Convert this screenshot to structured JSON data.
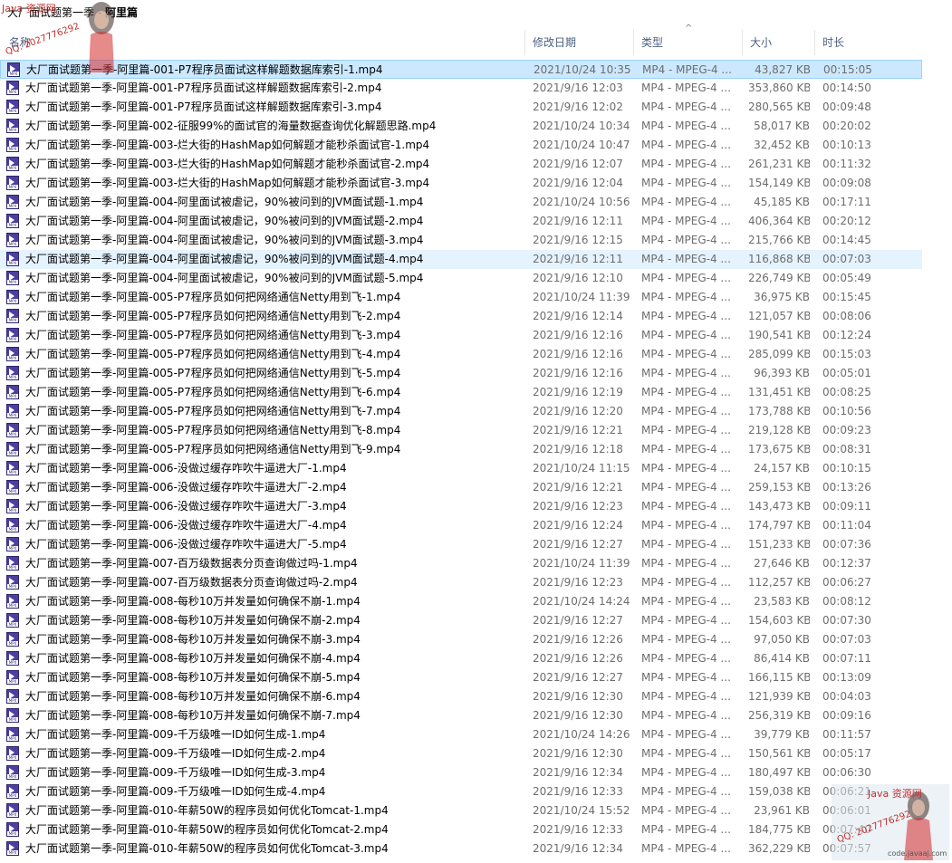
{
  "window": {
    "title_prefix": "大厂面试题第一季",
    "title_bold": "阿里篇"
  },
  "columns": {
    "name": "名称",
    "date": "修改日期",
    "type": "类型",
    "size": "大小",
    "duration": "时长"
  },
  "watermark": {
    "source_text": "Java 资源网",
    "qq_text": "QQ: 2027776292",
    "site_text": "code.javaaj.com"
  },
  "files": [
    {
      "name": "大厂面试题第一季-阿里篇-001-P7程序员面试这样解题数据库索引-1.mp4",
      "date": "2021/10/24 10:35",
      "type": "MP4 - MPEG-4 ...",
      "size": "43,827 KB",
      "duration": "00:15:05"
    },
    {
      "name": "大厂面试题第一季-阿里篇-001-P7程序员面试这样解题数据库索引-2.mp4",
      "date": "2021/9/16 12:03",
      "type": "MP4 - MPEG-4 ...",
      "size": "353,860 KB",
      "duration": "00:14:50"
    },
    {
      "name": "大厂面试题第一季-阿里篇-001-P7程序员面试这样解题数据库索引-3.mp4",
      "date": "2021/9/16 12:02",
      "type": "MP4 - MPEG-4 ...",
      "size": "280,565 KB",
      "duration": "00:09:48"
    },
    {
      "name": "大厂面试题第一季-阿里篇-002-征服99%的面试官的海量数据查询优化解题思路.mp4",
      "date": "2021/10/24 10:34",
      "type": "MP4 - MPEG-4 ...",
      "size": "58,017 KB",
      "duration": "00:20:02"
    },
    {
      "name": "大厂面试题第一季-阿里篇-003-烂大街的HashMap如何解题才能秒杀面试官-1.mp4",
      "date": "2021/10/24 10:47",
      "type": "MP4 - MPEG-4 ...",
      "size": "32,452 KB",
      "duration": "00:10:13"
    },
    {
      "name": "大厂面试题第一季-阿里篇-003-烂大街的HashMap如何解题才能秒杀面试官-2.mp4",
      "date": "2021/9/16 12:07",
      "type": "MP4 - MPEG-4 ...",
      "size": "261,231 KB",
      "duration": "00:11:32"
    },
    {
      "name": "大厂面试题第一季-阿里篇-003-烂大街的HashMap如何解题才能秒杀面试官-3.mp4",
      "date": "2021/9/16 12:04",
      "type": "MP4 - MPEG-4 ...",
      "size": "154,149 KB",
      "duration": "00:09:08"
    },
    {
      "name": "大厂面试题第一季-阿里篇-004-阿里面试被虐记，90%被问到的JVM面试题-1.mp4",
      "date": "2021/10/24 10:56",
      "type": "MP4 - MPEG-4 ...",
      "size": "45,185 KB",
      "duration": "00:17:11"
    },
    {
      "name": "大厂面试题第一季-阿里篇-004-阿里面试被虐记，90%被问到的JVM面试题-2.mp4",
      "date": "2021/9/16 12:11",
      "type": "MP4 - MPEG-4 ...",
      "size": "406,364 KB",
      "duration": "00:20:12"
    },
    {
      "name": "大厂面试题第一季-阿里篇-004-阿里面试被虐记，90%被问到的JVM面试题-3.mp4",
      "date": "2021/9/16 12:15",
      "type": "MP4 - MPEG-4 ...",
      "size": "215,766 KB",
      "duration": "00:14:45"
    },
    {
      "name": "大厂面试题第一季-阿里篇-004-阿里面试被虐记，90%被问到的JVM面试题-4.mp4",
      "date": "2021/9/16 12:11",
      "type": "MP4 - MPEG-4 ...",
      "size": "116,868 KB",
      "duration": "00:07:03"
    },
    {
      "name": "大厂面试题第一季-阿里篇-004-阿里面试被虐记，90%被问到的JVM面试题-5.mp4",
      "date": "2021/9/16 12:10",
      "type": "MP4 - MPEG-4 ...",
      "size": "226,749 KB",
      "duration": "00:05:49"
    },
    {
      "name": "大厂面试题第一季-阿里篇-005-P7程序员如何把网络通信Netty用到飞-1.mp4",
      "date": "2021/10/24 11:39",
      "type": "MP4 - MPEG-4 ...",
      "size": "36,975 KB",
      "duration": "00:15:45"
    },
    {
      "name": "大厂面试题第一季-阿里篇-005-P7程序员如何把网络通信Netty用到飞-2.mp4",
      "date": "2021/9/16 12:14",
      "type": "MP4 - MPEG-4 ...",
      "size": "121,057 KB",
      "duration": "00:08:06"
    },
    {
      "name": "大厂面试题第一季-阿里篇-005-P7程序员如何把网络通信Netty用到飞-3.mp4",
      "date": "2021/9/16 12:16",
      "type": "MP4 - MPEG-4 ...",
      "size": "190,541 KB",
      "duration": "00:12:24"
    },
    {
      "name": "大厂面试题第一季-阿里篇-005-P7程序员如何把网络通信Netty用到飞-4.mp4",
      "date": "2021/9/16 12:16",
      "type": "MP4 - MPEG-4 ...",
      "size": "285,099 KB",
      "duration": "00:15:03"
    },
    {
      "name": "大厂面试题第一季-阿里篇-005-P7程序员如何把网络通信Netty用到飞-5.mp4",
      "date": "2021/9/16 12:16",
      "type": "MP4 - MPEG-4 ...",
      "size": "96,393 KB",
      "duration": "00:05:01"
    },
    {
      "name": "大厂面试题第一季-阿里篇-005-P7程序员如何把网络通信Netty用到飞-6.mp4",
      "date": "2021/9/16 12:19",
      "type": "MP4 - MPEG-4 ...",
      "size": "131,451 KB",
      "duration": "00:08:25"
    },
    {
      "name": "大厂面试题第一季-阿里篇-005-P7程序员如何把网络通信Netty用到飞-7.mp4",
      "date": "2021/9/16 12:20",
      "type": "MP4 - MPEG-4 ...",
      "size": "173,788 KB",
      "duration": "00:10:56"
    },
    {
      "name": "大厂面试题第一季-阿里篇-005-P7程序员如何把网络通信Netty用到飞-8.mp4",
      "date": "2021/9/16 12:21",
      "type": "MP4 - MPEG-4 ...",
      "size": "219,128 KB",
      "duration": "00:09:23"
    },
    {
      "name": "大厂面试题第一季-阿里篇-005-P7程序员如何把网络通信Netty用到飞-9.mp4",
      "date": "2021/9/16 12:18",
      "type": "MP4 - MPEG-4 ...",
      "size": "173,675 KB",
      "duration": "00:08:31"
    },
    {
      "name": "大厂面试题第一季-阿里篇-006-没做过缓存咋吹牛逼进大厂-1.mp4",
      "date": "2021/10/24 11:15",
      "type": "MP4 - MPEG-4 ...",
      "size": "24,157 KB",
      "duration": "00:10:15"
    },
    {
      "name": "大厂面试题第一季-阿里篇-006-没做过缓存咋吹牛逼进大厂-2.mp4",
      "date": "2021/9/16 12:21",
      "type": "MP4 - MPEG-4 ...",
      "size": "259,153 KB",
      "duration": "00:13:26"
    },
    {
      "name": "大厂面试题第一季-阿里篇-006-没做过缓存咋吹牛逼进大厂-3.mp4",
      "date": "2021/9/16 12:23",
      "type": "MP4 - MPEG-4 ...",
      "size": "143,473 KB",
      "duration": "00:09:11"
    },
    {
      "name": "大厂面试题第一季-阿里篇-006-没做过缓存咋吹牛逼进大厂-4.mp4",
      "date": "2021/9/16 12:24",
      "type": "MP4 - MPEG-4 ...",
      "size": "174,797 KB",
      "duration": "00:11:04"
    },
    {
      "name": "大厂面试题第一季-阿里篇-006-没做过缓存咋吹牛逼进大厂-5.mp4",
      "date": "2021/9/16 12:27",
      "type": "MP4 - MPEG-4 ...",
      "size": "151,233 KB",
      "duration": "00:07:36"
    },
    {
      "name": "大厂面试题第一季-阿里篇-007-百万级数据表分页查询做过吗-1.mp4",
      "date": "2021/10/24 11:39",
      "type": "MP4 - MPEG-4 ...",
      "size": "27,646 KB",
      "duration": "00:12:37"
    },
    {
      "name": "大厂面试题第一季-阿里篇-007-百万级数据表分页查询做过吗-2.mp4",
      "date": "2021/9/16 12:23",
      "type": "MP4 - MPEG-4 ...",
      "size": "112,257 KB",
      "duration": "00:06:27"
    },
    {
      "name": "大厂面试题第一季-阿里篇-008-每秒10万并发量如何确保不崩-1.mp4",
      "date": "2021/10/24 14:24",
      "type": "MP4 - MPEG-4 ...",
      "size": "23,583 KB",
      "duration": "00:08:12"
    },
    {
      "name": "大厂面试题第一季-阿里篇-008-每秒10万并发量如何确保不崩-2.mp4",
      "date": "2021/9/16 12:27",
      "type": "MP4 - MPEG-4 ...",
      "size": "154,603 KB",
      "duration": "00:07:30"
    },
    {
      "name": "大厂面试题第一季-阿里篇-008-每秒10万并发量如何确保不崩-3.mp4",
      "date": "2021/9/16 12:26",
      "type": "MP4 - MPEG-4 ...",
      "size": "97,050 KB",
      "duration": "00:07:03"
    },
    {
      "name": "大厂面试题第一季-阿里篇-008-每秒10万并发量如何确保不崩-4.mp4",
      "date": "2021/9/16 12:26",
      "type": "MP4 - MPEG-4 ...",
      "size": "86,414 KB",
      "duration": "00:07:11"
    },
    {
      "name": "大厂面试题第一季-阿里篇-008-每秒10万并发量如何确保不崩-5.mp4",
      "date": "2021/9/16 12:27",
      "type": "MP4 - MPEG-4 ...",
      "size": "166,115 KB",
      "duration": "00:13:09"
    },
    {
      "name": "大厂面试题第一季-阿里篇-008-每秒10万并发量如何确保不崩-6.mp4",
      "date": "2021/9/16 12:30",
      "type": "MP4 - MPEG-4 ...",
      "size": "121,939 KB",
      "duration": "00:04:03"
    },
    {
      "name": "大厂面试题第一季-阿里篇-008-每秒10万并发量如何确保不崩-7.mp4",
      "date": "2021/9/16 12:30",
      "type": "MP4 - MPEG-4 ...",
      "size": "256,319 KB",
      "duration": "00:09:16"
    },
    {
      "name": "大厂面试题第一季-阿里篇-009-千万级唯一ID如何生成-1.mp4",
      "date": "2021/10/24 14:26",
      "type": "MP4 - MPEG-4 ...",
      "size": "39,779 KB",
      "duration": "00:11:57"
    },
    {
      "name": "大厂面试题第一季-阿里篇-009-千万级唯一ID如何生成-2.mp4",
      "date": "2021/9/16 12:30",
      "type": "MP4 - MPEG-4 ...",
      "size": "150,561 KB",
      "duration": "00:05:17"
    },
    {
      "name": "大厂面试题第一季-阿里篇-009-千万级唯一ID如何生成-3.mp4",
      "date": "2021/9/16 12:34",
      "type": "MP4 - MPEG-4 ...",
      "size": "180,497 KB",
      "duration": "00:06:30"
    },
    {
      "name": "大厂面试题第一季-阿里篇-009-千万级唯一ID如何生成-4.mp4",
      "date": "2021/9/16 12:33",
      "type": "MP4 - MPEG-4 ...",
      "size": "159,038 KB",
      "duration": "00:06:21"
    },
    {
      "name": "大厂面试题第一季-阿里篇-010-年薪50W的程序员如何优化Tomcat-1.mp4",
      "date": "2021/10/24 15:52",
      "type": "MP4 - MPEG-4 ...",
      "size": "23,961 KB",
      "duration": "00:06:01"
    },
    {
      "name": "大厂面试题第一季-阿里篇-010-年薪50W的程序员如何优化Tomcat-2.mp4",
      "date": "2021/9/16 12:33",
      "type": "MP4 - MPEG-4 ...",
      "size": "184,775 KB",
      "duration": "00:07:40"
    },
    {
      "name": "大厂面试题第一季-阿里篇-010-年薪50W的程序员如何优化Tomcat-3.mp4",
      "date": "2021/9/16 12:34",
      "type": "MP4 - MPEG-4 ...",
      "size": "362,229 KB",
      "duration": "00:07:57"
    }
  ],
  "selected_index": 0,
  "hover_index": 10,
  "colors": {
    "selection": "#cce8ff",
    "hover": "#e5f3ff",
    "header_text": "#4d6082",
    "icon": "#4b3fa0"
  }
}
